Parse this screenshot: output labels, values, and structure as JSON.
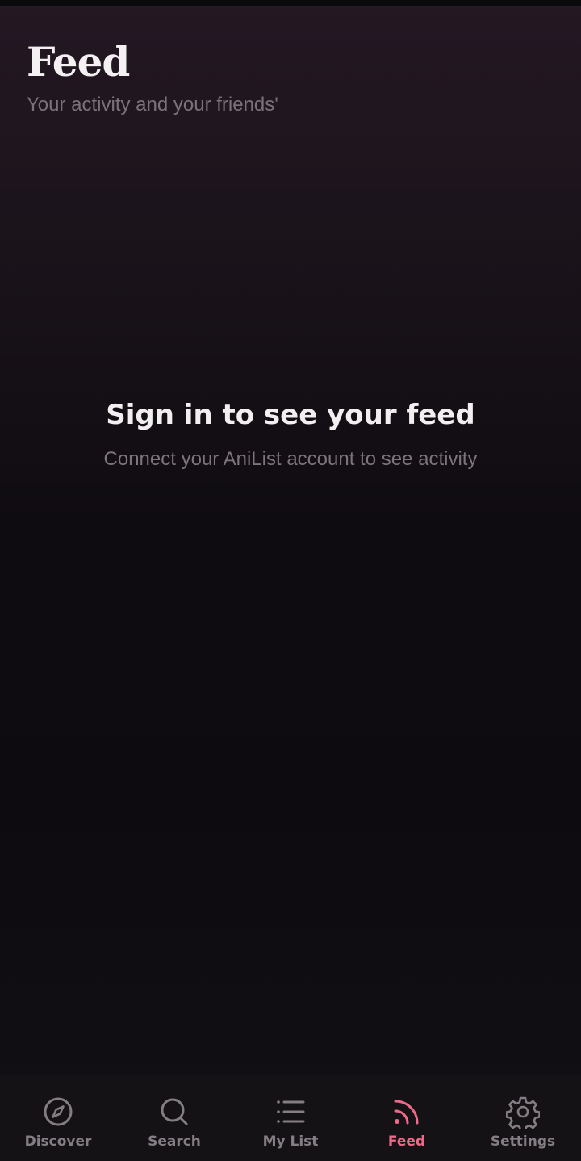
{
  "header": {
    "title": "Feed",
    "subtitle": "Your activity and your friends'"
  },
  "empty_state": {
    "title": "Sign in to see your feed",
    "message": "Connect your AniList account to see activity"
  },
  "tabbar": {
    "tabs": [
      {
        "label": "Discover",
        "icon": "compass-icon",
        "active": false
      },
      {
        "label": "Search",
        "icon": "search-icon",
        "active": false
      },
      {
        "label": "My List",
        "icon": "list-icon",
        "active": false
      },
      {
        "label": "Feed",
        "icon": "rss-icon",
        "active": true
      },
      {
        "label": "Settings",
        "icon": "gear-icon",
        "active": false
      }
    ]
  },
  "colors": {
    "accent": "#ef6a8a",
    "inactive": "#847d83",
    "background": "#0e0c10"
  }
}
